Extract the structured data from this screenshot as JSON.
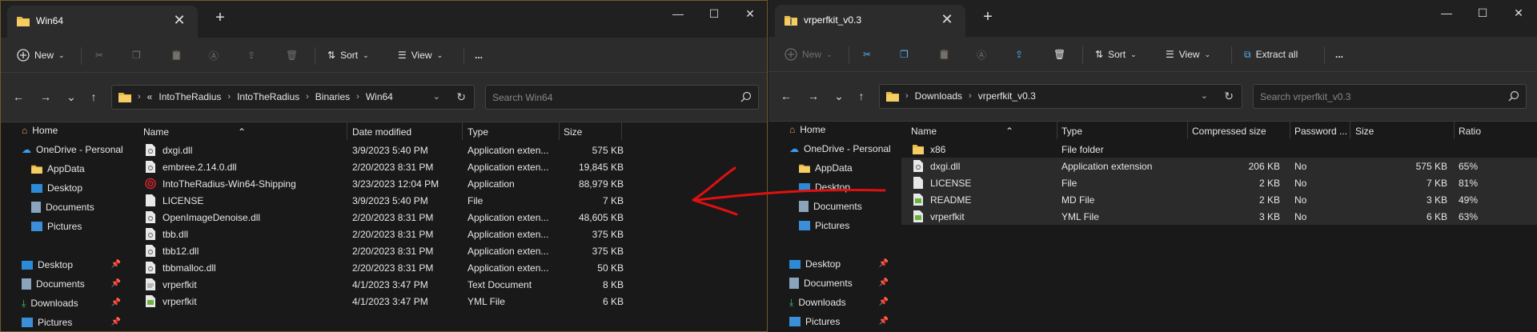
{
  "left": {
    "tab_title": "Win64",
    "toolbar": {
      "new": "New",
      "sort": "Sort",
      "view": "View",
      "more": "..."
    },
    "breadcrumb": {
      "overflow": "«",
      "parts": [
        "IntoTheRadius",
        "IntoTheRadius",
        "Binaries",
        "Win64"
      ]
    },
    "search_placeholder": "Search Win64",
    "nav": {
      "home": "Home",
      "onedrive": "OneDrive - Personal",
      "appdata": "AppData",
      "desktop": "Desktop",
      "documents": "Documents",
      "pictures": "Pictures",
      "qa_desktop": "Desktop",
      "qa_documents": "Documents",
      "qa_downloads": "Downloads",
      "qa_pictures": "Pictures"
    },
    "columns": [
      "Name",
      "Date modified",
      "Type",
      "Size"
    ],
    "rows": [
      {
        "name": "dxgi.dll",
        "date": "3/9/2023 5:40 PM",
        "type": "Application exten...",
        "size": "575 KB"
      },
      {
        "name": "embree.2.14.0.dll",
        "date": "2/20/2023 8:31 PM",
        "type": "Application exten...",
        "size": "19,845 KB"
      },
      {
        "name": "IntoTheRadius-Win64-Shipping",
        "date": "3/23/2023 12:04 PM",
        "type": "Application",
        "size": "88,979 KB"
      },
      {
        "name": "LICENSE",
        "date": "3/9/2023 5:40 PM",
        "type": "File",
        "size": "7 KB"
      },
      {
        "name": "OpenImageDenoise.dll",
        "date": "2/20/2023 8:31 PM",
        "type": "Application exten...",
        "size": "48,605 KB"
      },
      {
        "name": "tbb.dll",
        "date": "2/20/2023 8:31 PM",
        "type": "Application exten...",
        "size": "375 KB"
      },
      {
        "name": "tbb12.dll",
        "date": "2/20/2023 8:31 PM",
        "type": "Application exten...",
        "size": "375 KB"
      },
      {
        "name": "tbbmalloc.dll",
        "date": "2/20/2023 8:31 PM",
        "type": "Application exten...",
        "size": "50 KB"
      },
      {
        "name": "vrperfkit",
        "date": "4/1/2023 3:47 PM",
        "type": "Text Document",
        "size": "8 KB"
      },
      {
        "name": "vrperfkit",
        "date": "4/1/2023 3:47 PM",
        "type": "YML File",
        "size": "6 KB"
      }
    ]
  },
  "right": {
    "tab_title": "vrperfkit_v0.3",
    "toolbar": {
      "new": "New",
      "sort": "Sort",
      "view": "View",
      "extract": "Extract all",
      "more": "..."
    },
    "breadcrumb": {
      "parts": [
        "Downloads",
        "vrperfkit_v0.3"
      ]
    },
    "search_placeholder": "Search vrperfkit_v0.3",
    "nav": {
      "home": "Home",
      "onedrive": "OneDrive - Personal",
      "appdata": "AppData",
      "desktop": "Desktop",
      "documents": "Documents",
      "pictures": "Pictures",
      "qa_desktop": "Desktop",
      "qa_documents": "Documents",
      "qa_downloads": "Downloads",
      "qa_pictures": "Pictures"
    },
    "columns": [
      "Name",
      "Type",
      "Compressed size",
      "Password ...",
      "Size",
      "Ratio"
    ],
    "rows": [
      {
        "name": "x86",
        "type": "File folder",
        "csize": "",
        "pw": "",
        "size": "",
        "ratio": ""
      },
      {
        "name": "dxgi.dll",
        "type": "Application extension",
        "csize": "206 KB",
        "pw": "No",
        "size": "575 KB",
        "ratio": "65%"
      },
      {
        "name": "LICENSE",
        "type": "File",
        "csize": "2 KB",
        "pw": "No",
        "size": "7 KB",
        "ratio": "81%"
      },
      {
        "name": "README",
        "type": "MD File",
        "csize": "2 KB",
        "pw": "No",
        "size": "3 KB",
        "ratio": "49%"
      },
      {
        "name": "vrperfkit",
        "type": "YML File",
        "csize": "3 KB",
        "pw": "No",
        "size": "6 KB",
        "ratio": "63%"
      }
    ]
  },
  "colors": {
    "accent_arrow": "#e01010",
    "folder": "#e8b94a"
  }
}
